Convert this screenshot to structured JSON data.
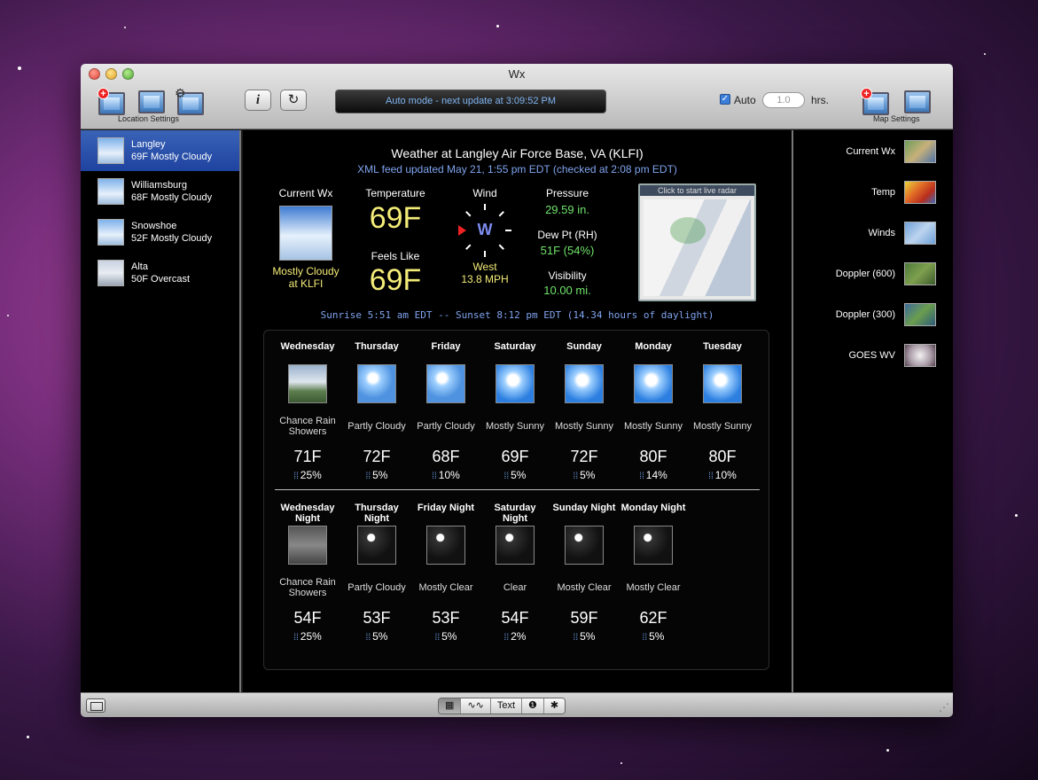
{
  "window": {
    "title": "Wx"
  },
  "toolbar": {
    "location_settings_label": "Location Settings",
    "map_settings_label": "Map Settings",
    "status": "Auto mode - next update at 3:09:52 PM",
    "auto_label": "Auto",
    "auto_checked": true,
    "hours_placeholder": "1.0",
    "hours_label": "hrs."
  },
  "locations": [
    {
      "name": "Langley",
      "summary": "69F Mostly Cloudy",
      "selected": true
    },
    {
      "name": "Williamsburg",
      "summary": "68F Mostly Cloudy"
    },
    {
      "name": "Snowshoe",
      "summary": "52F Mostly Cloudy"
    },
    {
      "name": "Alta",
      "summary": "50F Overcast"
    }
  ],
  "current": {
    "title": "Weather at Langley Air Force Base, VA (KLFI)",
    "updated": "XML feed updated May 21, 1:55 pm EDT (checked at 2:08 pm EDT)",
    "current_wx_head": "Current Wx",
    "condition_line1": "Mostly Cloudy",
    "condition_line2": "at KLFI",
    "temperature_head": "Temperature",
    "temperature": "69F",
    "feels_like_head": "Feels Like",
    "feels_like": "69F",
    "wind_head": "Wind",
    "wind_letter": "W",
    "wind_dir": "West",
    "wind_speed": "13.8 MPH",
    "pressure_head": "Pressure",
    "pressure": "29.59 in.",
    "dew_head": "Dew Pt (RH)",
    "dew": "51F (54%)",
    "visibility_head": "Visibility",
    "visibility": "10.00 mi.",
    "radar_label": "Click to start live radar",
    "sun_line": "Sunrise 5:51 am EDT -- Sunset 8:12 pm EDT (14.34 hours of daylight)"
  },
  "forecast_day": [
    {
      "name": "Wednesday",
      "desc": "Chance Rain Showers",
      "temp": "71F",
      "precip": "25%",
      "icon": "rain-icon"
    },
    {
      "name": "Thursday",
      "desc": "Partly Cloudy",
      "temp": "72F",
      "precip": "5%",
      "icon": "partly-cloudy-icon"
    },
    {
      "name": "Friday",
      "desc": "Partly Cloudy",
      "temp": "68F",
      "precip": "10%",
      "icon": "partly-cloudy-icon"
    },
    {
      "name": "Saturday",
      "desc": "Mostly Sunny",
      "temp": "69F",
      "precip": "5%",
      "icon": "sun-icon"
    },
    {
      "name": "Sunday",
      "desc": "Mostly Sunny",
      "temp": "72F",
      "precip": "5%",
      "icon": "sun-icon"
    },
    {
      "name": "Monday",
      "desc": "Mostly Sunny",
      "temp": "80F",
      "precip": "14%",
      "icon": "sun-icon"
    },
    {
      "name": "Tuesday",
      "desc": "Mostly Sunny",
      "temp": "80F",
      "precip": "10%",
      "icon": "sun-icon"
    }
  ],
  "forecast_night": [
    {
      "name": "Wednesday Night",
      "desc": "Chance Rain Showers",
      "temp": "54F",
      "precip": "25%",
      "icon": "night-rain-icon"
    },
    {
      "name": "Thursday Night",
      "desc": "Partly Cloudy",
      "temp": "53F",
      "precip": "5%",
      "icon": "night-cloudy-icon"
    },
    {
      "name": "Friday Night",
      "desc": "Mostly Clear",
      "temp": "53F",
      "precip": "5%",
      "icon": "night-clear-icon"
    },
    {
      "name": "Saturday Night",
      "desc": "Clear",
      "temp": "54F",
      "precip": "2%",
      "icon": "night-clear-icon"
    },
    {
      "name": "Sunday Night",
      "desc": "Mostly Clear",
      "temp": "59F",
      "precip": "5%",
      "icon": "night-clear-icon"
    },
    {
      "name": "Monday Night",
      "desc": "Mostly Clear",
      "temp": "62F",
      "precip": "5%",
      "icon": "night-clear-icon"
    }
  ],
  "maps": [
    {
      "label": "Current Wx"
    },
    {
      "label": "Temp"
    },
    {
      "label": "Winds"
    },
    {
      "label": "Doppler (600)"
    },
    {
      "label": "Doppler (300)"
    },
    {
      "label": "GOES WV"
    }
  ],
  "bottombar": {
    "tabs": [
      "keyboard-icon",
      "graph-icon",
      "Text",
      "alert-icon",
      "gear-icon"
    ],
    "text_tab": "Text"
  }
}
